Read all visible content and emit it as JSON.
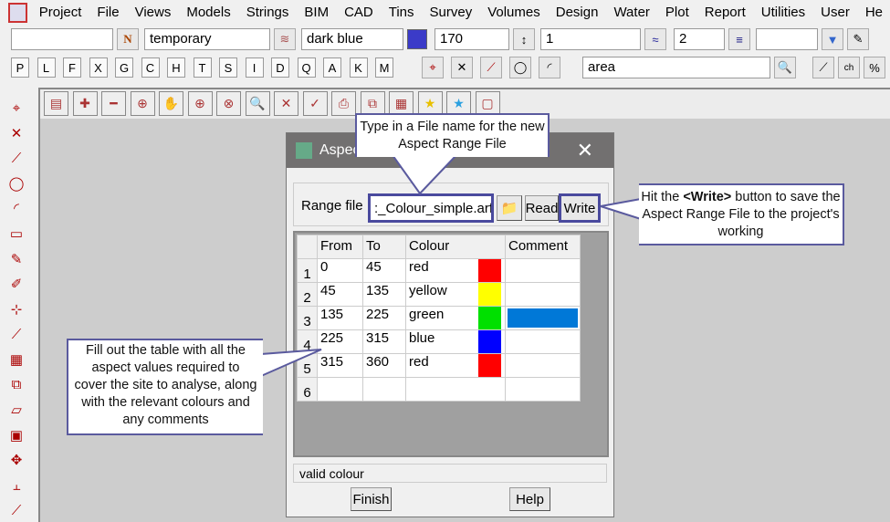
{
  "menu": [
    "Project",
    "File",
    "Views",
    "Models",
    "Strings",
    "BIM",
    "CAD",
    "Tins",
    "Survey",
    "Volumes",
    "Design",
    "Water",
    "Plot",
    "Report",
    "Utilities",
    "User",
    "He"
  ],
  "toolbar": {
    "name_value": "",
    "layer": "temporary",
    "colour": "dark blue",
    "colour_hex": "#3b3bc8",
    "weight": "170",
    "linestyle": "1",
    "thickness": "2",
    "last": "",
    "search": "area",
    "letters": [
      "P",
      "L",
      "F",
      "X",
      "G",
      "C",
      "H",
      "T",
      "S",
      "I",
      "D",
      "Q",
      "A",
      "K",
      "M"
    ]
  },
  "dialog": {
    "title": "Aspec",
    "range_label": "Range file",
    "range_value": ":_Colour_simple.arf",
    "read": "Read",
    "write": "Write",
    "status": "valid colour",
    "finish": "Finish",
    "help": "Help",
    "columns": [
      "From",
      "To",
      "Colour",
      "Comment"
    ],
    "rows": [
      {
        "n": "1",
        "from": "0",
        "to": "45",
        "colour": "red",
        "hex": "#ff0000"
      },
      {
        "n": "2",
        "from": "45",
        "to": "135",
        "colour": "yellow",
        "hex": "#ffff00"
      },
      {
        "n": "3",
        "from": "135",
        "to": "225",
        "colour": "green",
        "hex": "#00e000"
      },
      {
        "n": "4",
        "from": "225",
        "to": "315",
        "colour": "blue",
        "hex": "#0000ff"
      },
      {
        "n": "5",
        "from": "315",
        "to": "360",
        "colour": "red",
        "hex": "#ff0000"
      },
      {
        "n": "6",
        "from": "",
        "to": "",
        "colour": "",
        "hex": ""
      }
    ]
  },
  "callouts": {
    "top": "Type in a File name for the new Aspect Range File",
    "right_pre": "Hit the ",
    "right_bold": "<Write>",
    "right_post": " button to save the Aspect Range File to the project's working",
    "left": "Fill out the table with all the aspect values required to cover the site to analyse, along with the relevant colours and any comments"
  }
}
